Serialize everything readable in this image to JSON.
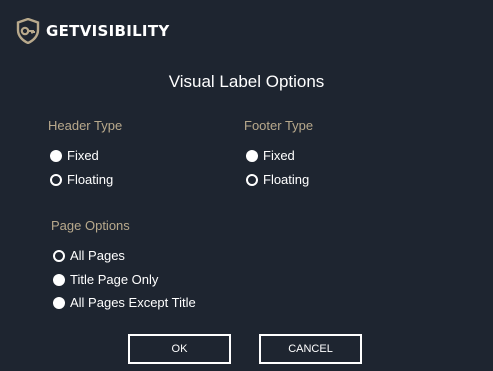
{
  "brand": {
    "name": "GETVISIBILITY",
    "accent": "#b8a98c",
    "background": "#1e2530"
  },
  "dialog": {
    "title": "Visual Label Options"
  },
  "header_type": {
    "label": "Header Type",
    "options": [
      {
        "label": "Fixed",
        "selected": true
      },
      {
        "label": "Floating",
        "selected": false
      }
    ]
  },
  "footer_type": {
    "label": "Footer Type",
    "options": [
      {
        "label": "Fixed",
        "selected": true
      },
      {
        "label": "Floating",
        "selected": false
      }
    ]
  },
  "page_options": {
    "label": "Page Options",
    "options": [
      {
        "label": "All Pages",
        "selected": false
      },
      {
        "label": "Title Page Only",
        "selected": true
      },
      {
        "label": "All Pages Except Title",
        "selected": true
      }
    ]
  },
  "buttons": {
    "ok": "OK",
    "cancel": "CANCEL"
  }
}
